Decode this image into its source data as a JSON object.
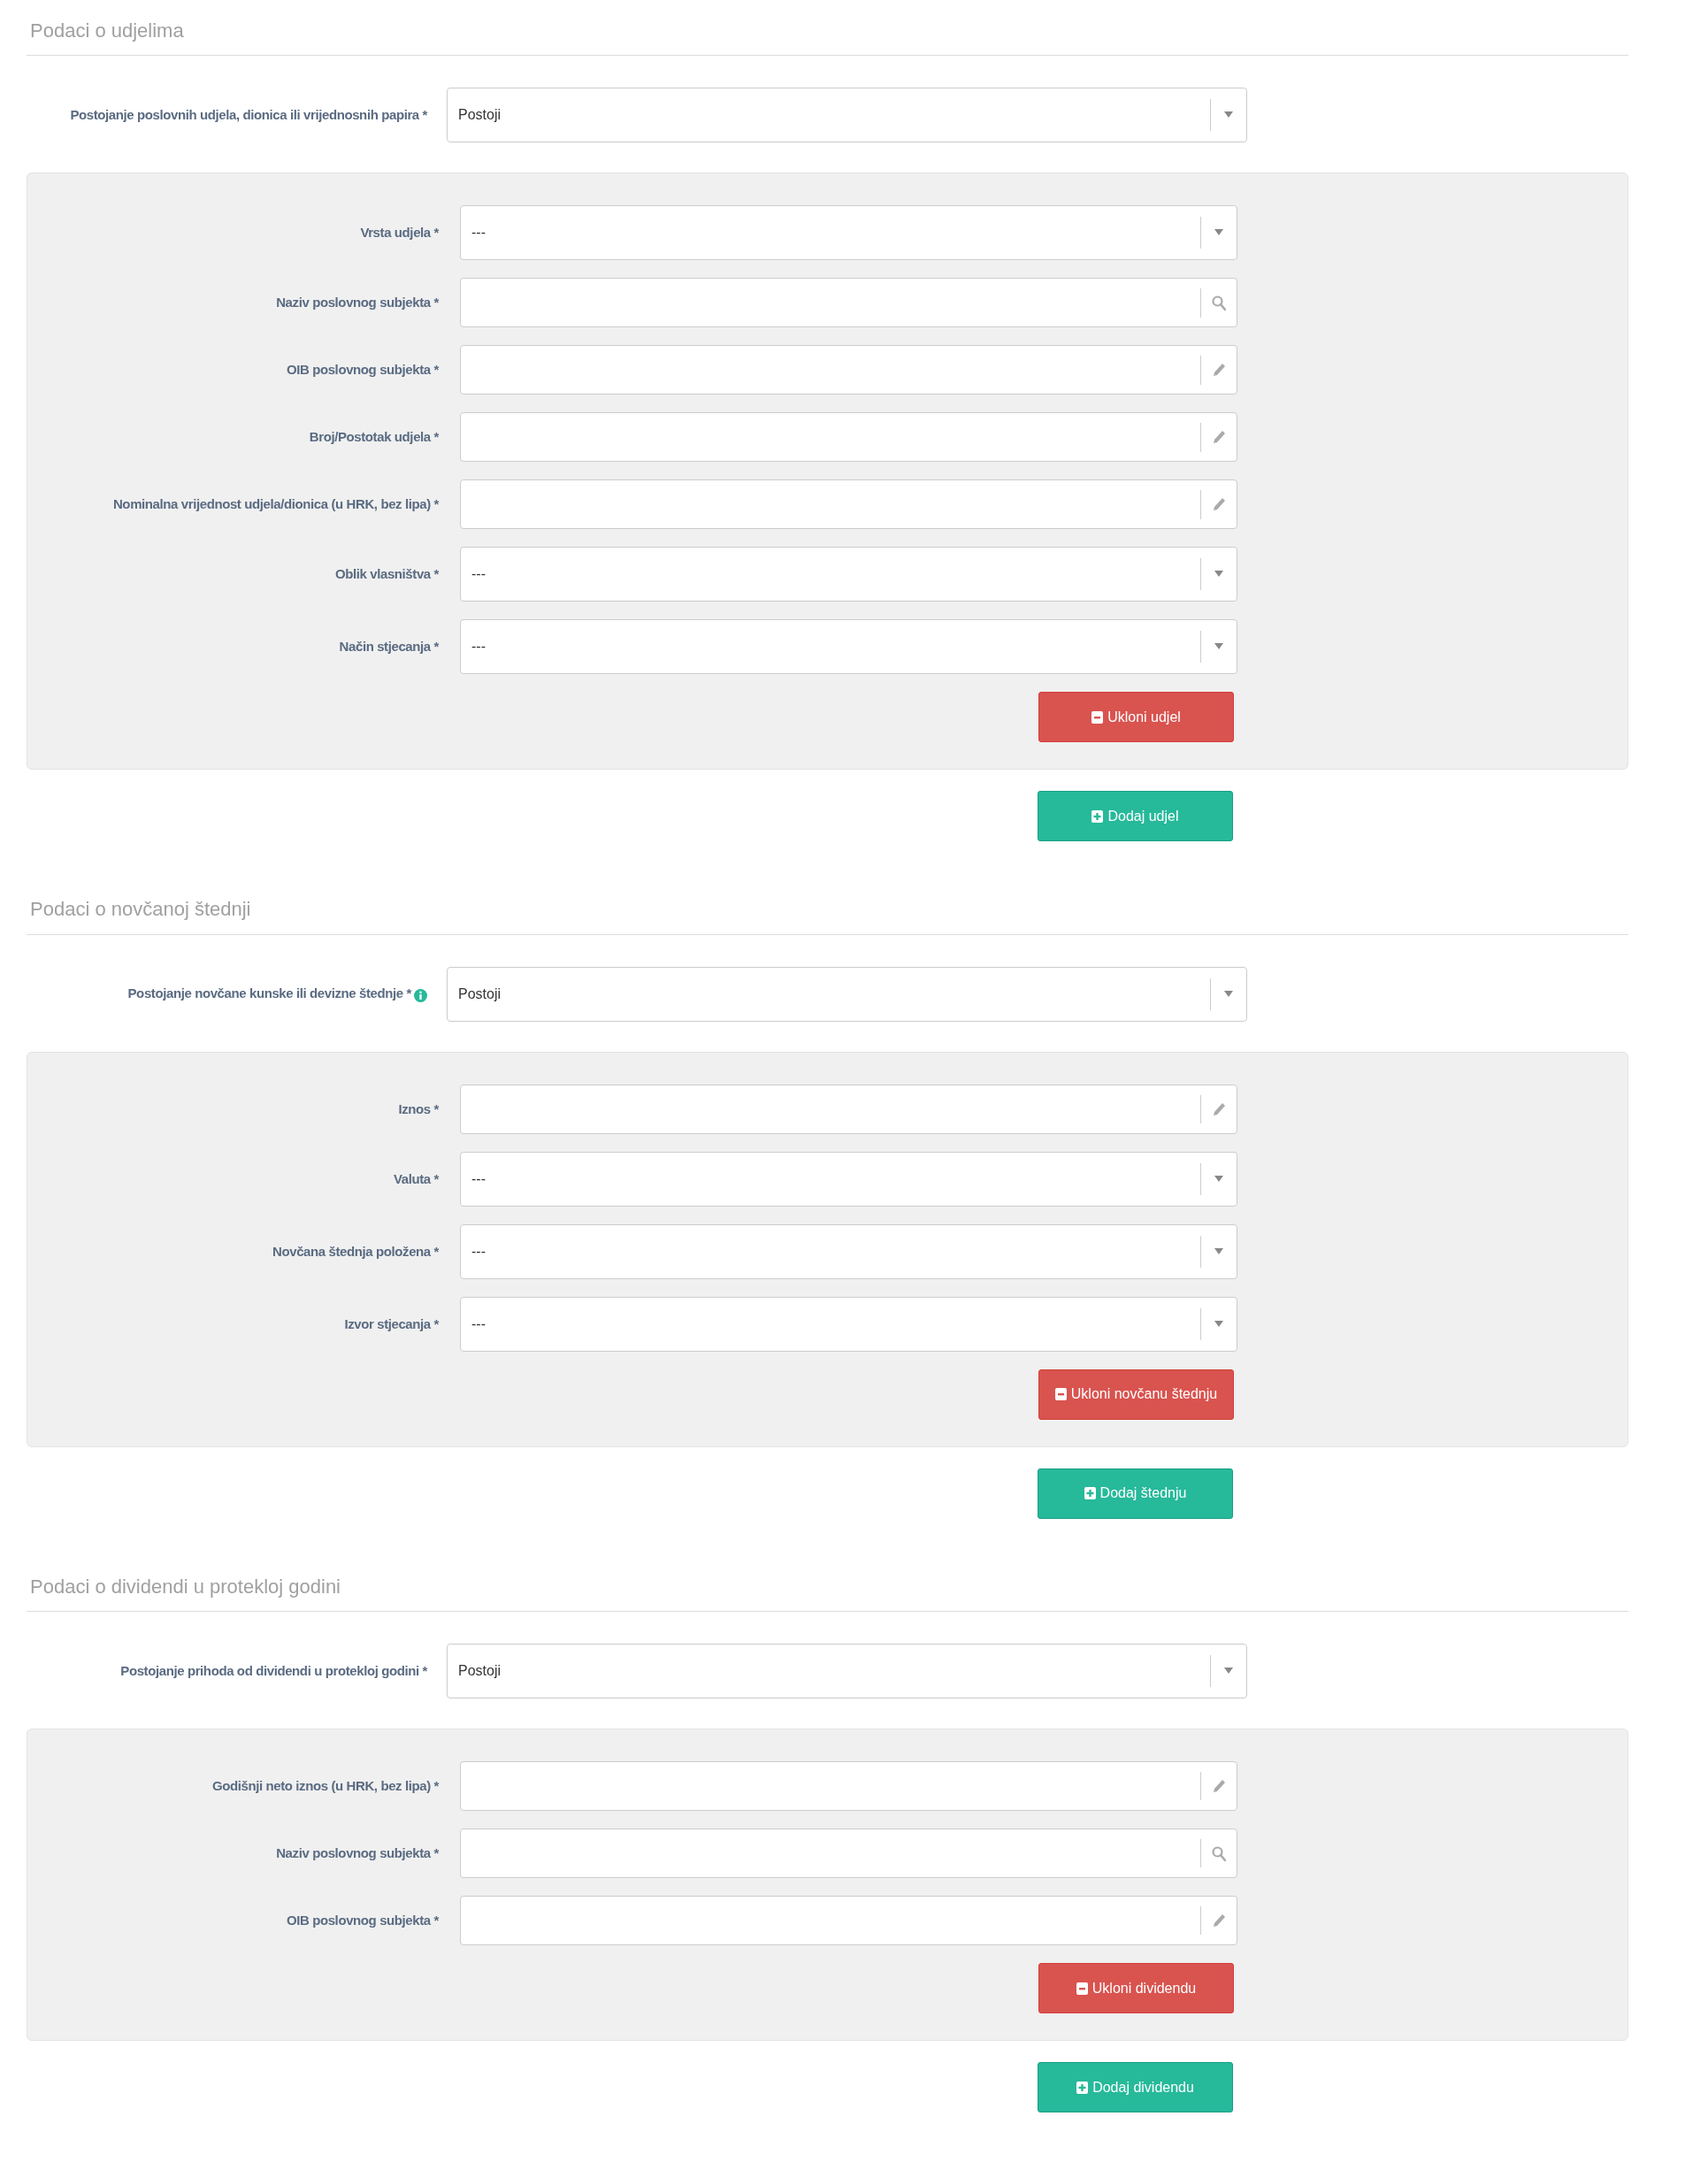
{
  "sections": [
    {
      "title": "Podaci o udjelima",
      "exists_field": {
        "label": "Postojanje poslovnih udjela, dionica ili vrijednosnih papira *",
        "info": false,
        "value": "Postoji"
      },
      "entries": [
        {
          "fields": [
            {
              "label": "Vrsta udjela *",
              "kind": "select",
              "value": "---"
            },
            {
              "label": "Naziv poslovnog subjekta *",
              "kind": "search"
            },
            {
              "label": "OIB poslovnog subjekta *",
              "kind": "text"
            },
            {
              "label": "Broj/Postotak udjela *",
              "kind": "text"
            },
            {
              "label": "Nominalna vrijednost udjela/dionica (u HRK, bez lipa) *",
              "kind": "text"
            },
            {
              "label": "Oblik vlasništva *",
              "kind": "select",
              "value": "---"
            },
            {
              "label": "Način stjecanja *",
              "kind": "select",
              "value": "---"
            }
          ],
          "remove_button": "Ukloni udjel"
        }
      ],
      "add_button": "Dodaj udjel"
    },
    {
      "title": "Podaci o novčanoj štednji",
      "exists_field": {
        "label": "Postojanje novčane kunske ili devizne štednje *",
        "info": true,
        "value": "Postoji"
      },
      "entries": [
        {
          "fields": [
            {
              "label": "Iznos *",
              "kind": "text"
            },
            {
              "label": "Valuta *",
              "kind": "select",
              "value": "---"
            },
            {
              "label": "Novčana štednja položena *",
              "kind": "select",
              "value": "---"
            },
            {
              "label": "Izvor stjecanja *",
              "kind": "select",
              "value": "---"
            }
          ],
          "remove_button": "Ukloni novčanu štednju"
        }
      ],
      "add_button": "Dodaj štednju"
    },
    {
      "title": "Podaci o dividendi u protekloj godini",
      "exists_field": {
        "label": "Postojanje prihoda od dividendi u protekloj godini *",
        "info": false,
        "value": "Postoji"
      },
      "entries": [
        {
          "fields": [
            {
              "label": "Godišnji neto iznos (u HRK, bez lipa) *",
              "kind": "text"
            },
            {
              "label": "Naziv poslovnog subjekta *",
              "kind": "search"
            },
            {
              "label": "OIB poslovnog subjekta *",
              "kind": "text"
            }
          ],
          "remove_button": "Ukloni dividendu"
        }
      ],
      "add_button": "Dodaj dividendu"
    }
  ]
}
